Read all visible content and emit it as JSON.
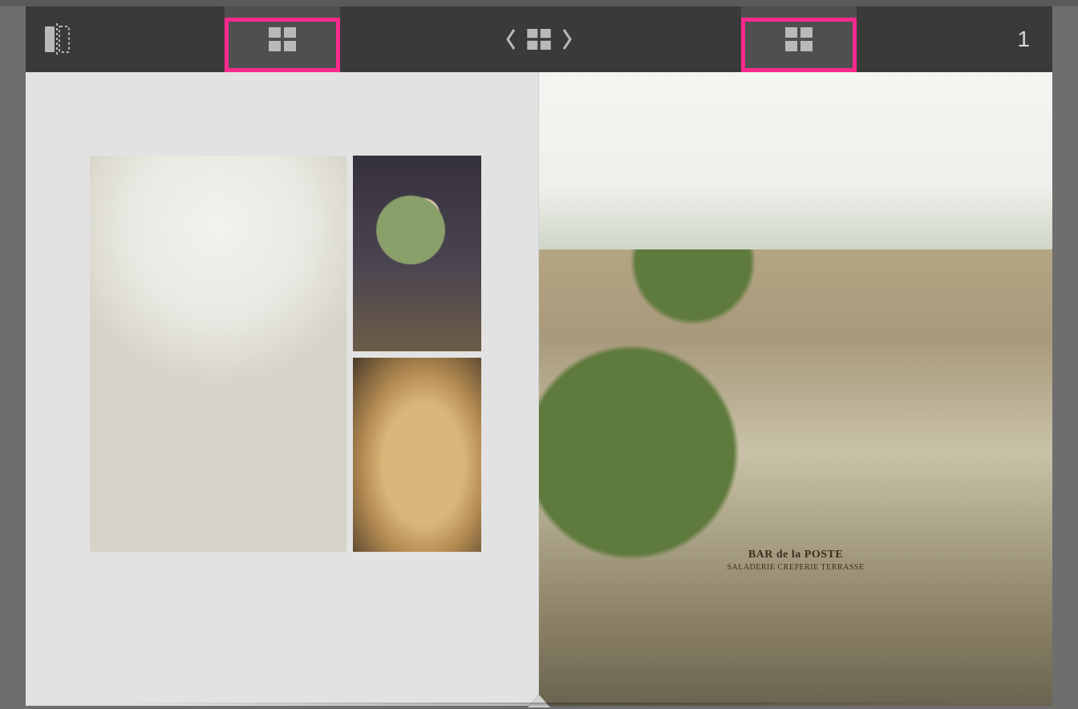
{
  "toolbar": {
    "page_number": "1",
    "icons": {
      "split_view": "split-view-icon",
      "grid_left": "grid-icon",
      "grid_center": "grid-icon",
      "grid_right": "grid-icon",
      "prev": "chevron-left-icon",
      "next": "chevron-right-icon"
    }
  },
  "highlight_color": "#ff2a8d",
  "spread": {
    "right_page_sign_line1": "BAR de la POSTE",
    "right_page_sign_line2": "SALADERIE CREPERIE TERRASSE"
  }
}
